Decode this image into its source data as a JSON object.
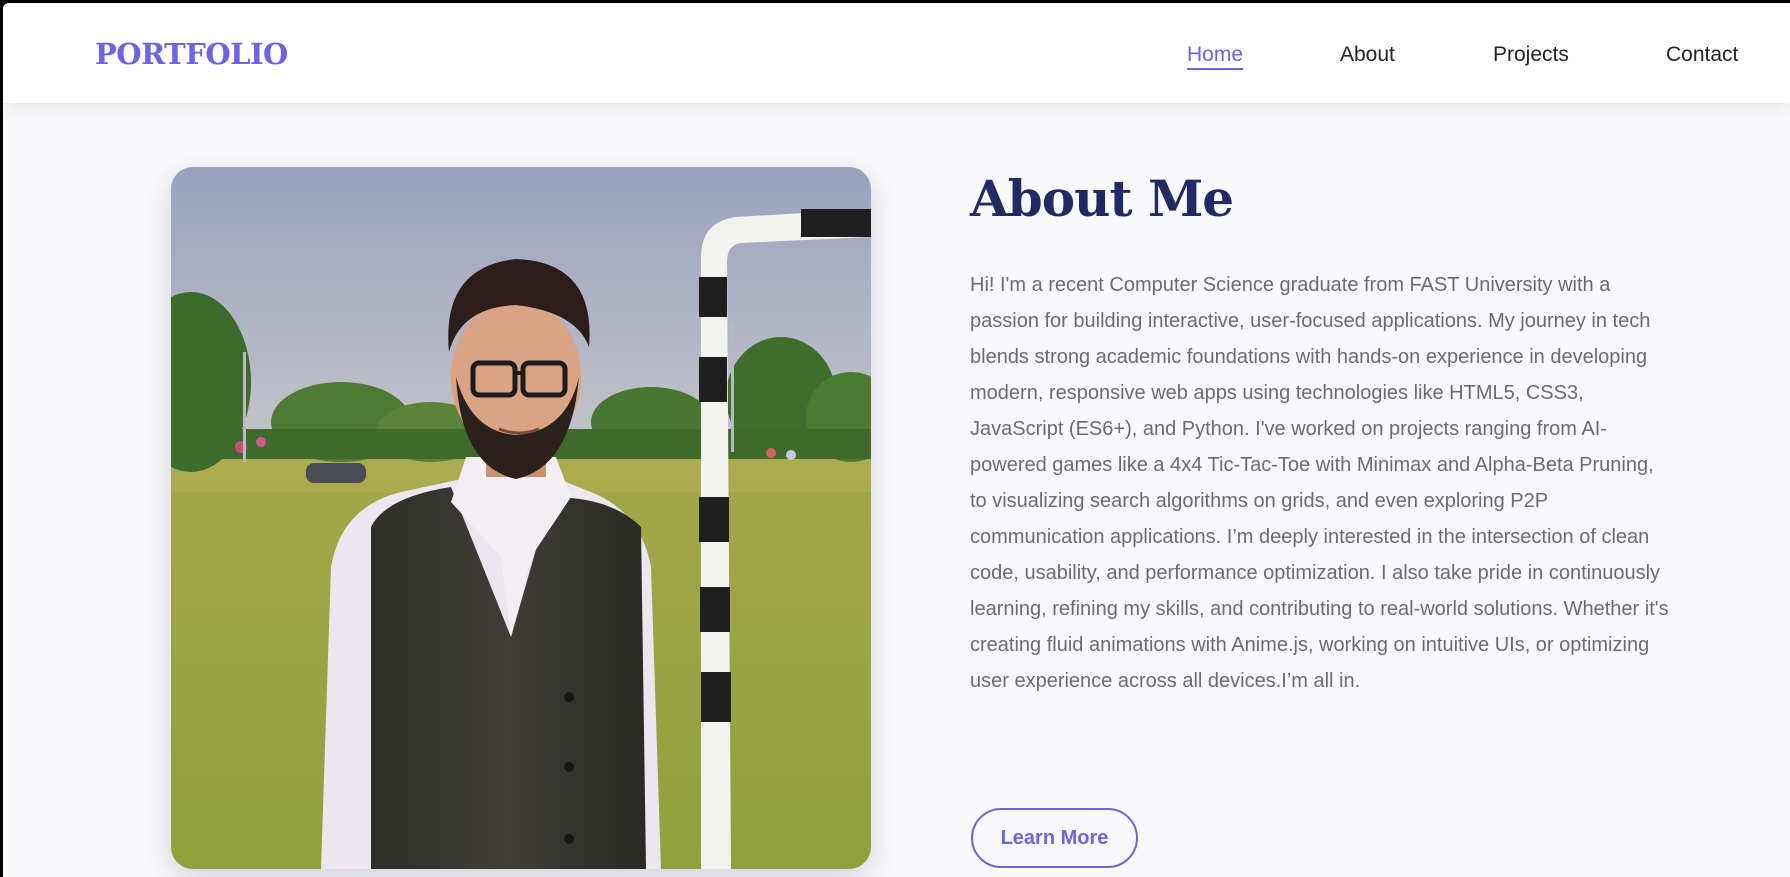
{
  "brand": {
    "logo_text": "PORTFOLIO",
    "accent_color": "#6c63e8"
  },
  "nav": {
    "items": [
      {
        "label": "Home",
        "active": true
      },
      {
        "label": "About",
        "active": false
      },
      {
        "label": "Projects",
        "active": false
      },
      {
        "label": "Contact",
        "active": false
      }
    ]
  },
  "about": {
    "title": "About Me",
    "title_color": "#222a66",
    "body": "Hi! I'm a recent Computer Science graduate from FAST University with a passion for building interactive, user-focused applications. My journey in tech blends strong academic foundations with hands-on experience in developing modern, responsive web apps using technologies like HTML5, CSS3, JavaScript (ES6+), and Python. I've worked on projects ranging from AI-powered games like a 4x4 Tic-Tac-Toe with Minimax and Alpha-Beta Pruning, to visualizing search algorithms on grids, and even exploring P2P communication applications. I’m deeply interested in the intersection of clean code, usability, and performance optimization. I also take pride in continuously learning, refining my skills, and contributing to real-world solutions. Whether it's creating fluid animations with Anime.js, working on intuitive UIs, or optimizing user experience across all devices.I’m all in.",
    "cta_label": "Learn More"
  },
  "photo": {
    "icon": "profile-photo"
  }
}
